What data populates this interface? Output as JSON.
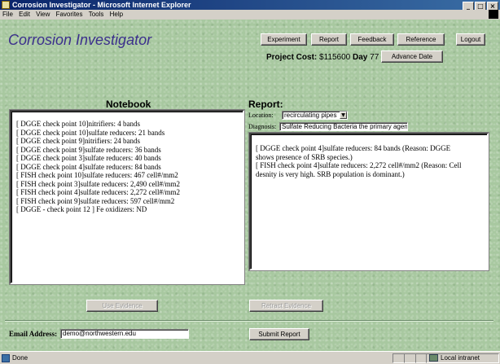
{
  "window": {
    "title": "Corrosion Investigator - Microsoft Internet Explorer",
    "controls": [
      "_",
      "□",
      "×"
    ]
  },
  "menubar": {
    "items": [
      "File",
      "Edit",
      "View",
      "Favorites",
      "Tools",
      "Help"
    ]
  },
  "app": {
    "title": "Corrosion Investigator",
    "nav": {
      "experiment": "Experiment",
      "report": "Report",
      "feedback": "Feedback",
      "reference": "Reference",
      "logout": "Logout"
    },
    "cost_label": "Project Cost:",
    "cost_value": "$115600",
    "day_label": "Day",
    "day_value": "77",
    "advance_date": "Advance Date"
  },
  "notebook": {
    "title": "Notebook",
    "entries": [
      "[ DGGE check point 10]nitrifiers: 4 bands",
      "[ DGGE check point 10]sulfate reducers: 21 bands",
      "[ DGGE check point 9]nitrifiers: 24 bands",
      "[ DGGE check point 9]sulfate reducers: 36 bands",
      "[ DGGE check point 3]sulfate reducers: 40 bands",
      "[ DGGE check point 4]sulfate reducers: 84 bands",
      "[ FISH check point 10]sulfate reducers: 467 cell#/mm2",
      "[ FISH check point 3]sulfate reducers: 2,490 cell#/mm2",
      "[ FISH check point 4]sulfate reducers: 2,272 cell#/mm2",
      "[ FISH check point 9]sulfate reducers: 597 cell#/mm2",
      "[ DGGE - check point 12 ] Fe oxidizers: ND"
    ],
    "use_evidence": "Use Evidence"
  },
  "report": {
    "title": "Report:",
    "location_label": "Location:",
    "location_value": "recirculating pipes",
    "diagnosis_label": "Diagnosis:",
    "diagnosis_value": "Sulfate Reducing Bacteria the primary agen",
    "entries": [
      "[ DGGE check point 4]sulfate reducers: 84 bands (Reason: DGGE",
      "shows presence of SRB species.)",
      "[ FISH check point 4]sulfate reducers: 2,272 cell#/mm2 (Reason: Cell",
      "desnity is very high. SRB population is dominant.)"
    ],
    "retract_evidence": "Retract Evidence"
  },
  "footer": {
    "email_label": "Email Address:",
    "email_value": "demo@northwestern.edu",
    "submit": "Submit Report"
  },
  "statusbar": {
    "status": "Done",
    "zone": "Local intranet"
  }
}
